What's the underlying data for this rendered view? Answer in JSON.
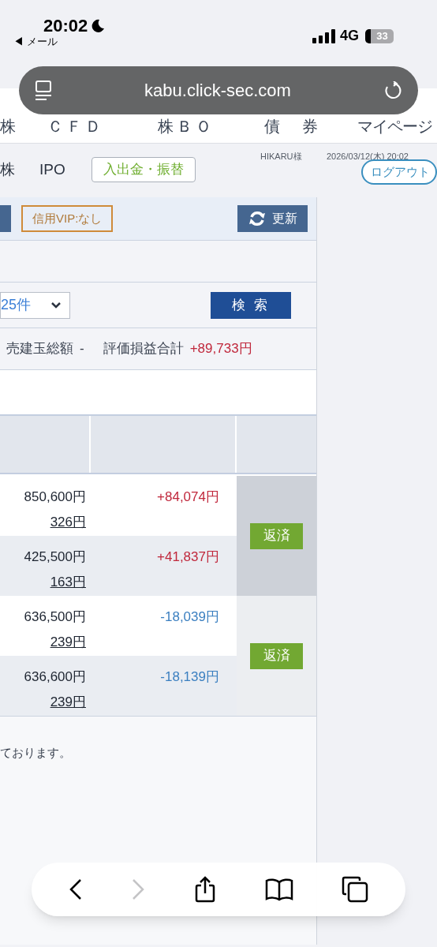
{
  "status_bar": {
    "time": "20:02",
    "back_label": "◀ メール",
    "network": "4G",
    "battery": "33"
  },
  "address_bar": {
    "url": "kabu.click-sec.com"
  },
  "nav_tabs": [
    {
      "label": "株"
    },
    {
      "label": "ＣＦＤ"
    },
    {
      "label": "株ＢＯ"
    },
    {
      "label": "債　券"
    },
    {
      "label": "マイページ"
    }
  ],
  "sub_nav": [
    {
      "label": "株"
    },
    {
      "label": "IPO"
    }
  ],
  "deposit_button": "入出金・振替",
  "user": "HIKARU様",
  "datetime": "2026/03/12(木) 20:02",
  "logout_button": "ログアウト",
  "vip_badge": "信用VIP:なし",
  "refresh_button": "更新",
  "page_size": "25件",
  "search_button": "検 索",
  "summary": [
    {
      "label": "売建玉総額",
      "value": "-"
    },
    {
      "label": "評価損益合計",
      "value": "+89,733円",
      "kind": "gain"
    }
  ],
  "position_groups": [
    {
      "button": "返済",
      "highlighted": true,
      "rows": [
        {
          "amount": "850,600円",
          "price": "326円",
          "pnl": "+84,074円",
          "kind": "gain"
        },
        {
          "amount": "425,500円",
          "price": "163円",
          "pnl": "+41,837円",
          "kind": "gain"
        }
      ]
    },
    {
      "button": "返済",
      "highlighted": false,
      "rows": [
        {
          "amount": "636,500円",
          "price": "239円",
          "pnl": "-18,039円",
          "kind": "loss"
        },
        {
          "amount": "636,600円",
          "price": "239円",
          "pnl": "-18,139円",
          "kind": "loss"
        }
      ]
    }
  ],
  "footer_note": "ております。",
  "browser_toolbar": {
    "forward_disabled": true
  }
}
